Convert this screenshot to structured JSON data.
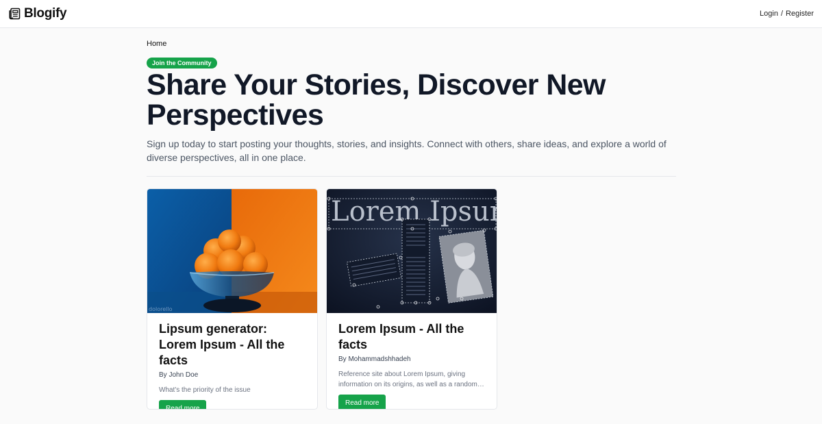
{
  "nav": {
    "brand": "Blogify",
    "login": "Login",
    "separator": "/",
    "register": "Register"
  },
  "breadcrumb": "Home",
  "hero": {
    "badge": "Join the Community",
    "title": "Share Your Stories, Discover New Perspectives",
    "subtitle": "Sign up today to start posting your thoughts, stories, and insights. Connect with others, share ideas, and explore a world of diverse perspectives, all in one place."
  },
  "posts": [
    {
      "title": "Lipsum generator: Lorem Ipsum - All the facts",
      "author": "By John Doe",
      "excerpt": "What's the priority of the issue",
      "button": "Read more",
      "image_watermark": "dolorello"
    },
    {
      "title": "Lorem Ipsum - All the facts",
      "author": "By Mohammadshhadeh",
      "excerpt": "Reference site about Lorem Ipsum, giving information on its origins, as well as a random Lipsum generator.",
      "button": "Read more",
      "image_text": "Lorem Ipsum"
    }
  ],
  "colors": {
    "accent": "#16a34a",
    "text": "#111827",
    "muted": "#4b5563"
  }
}
